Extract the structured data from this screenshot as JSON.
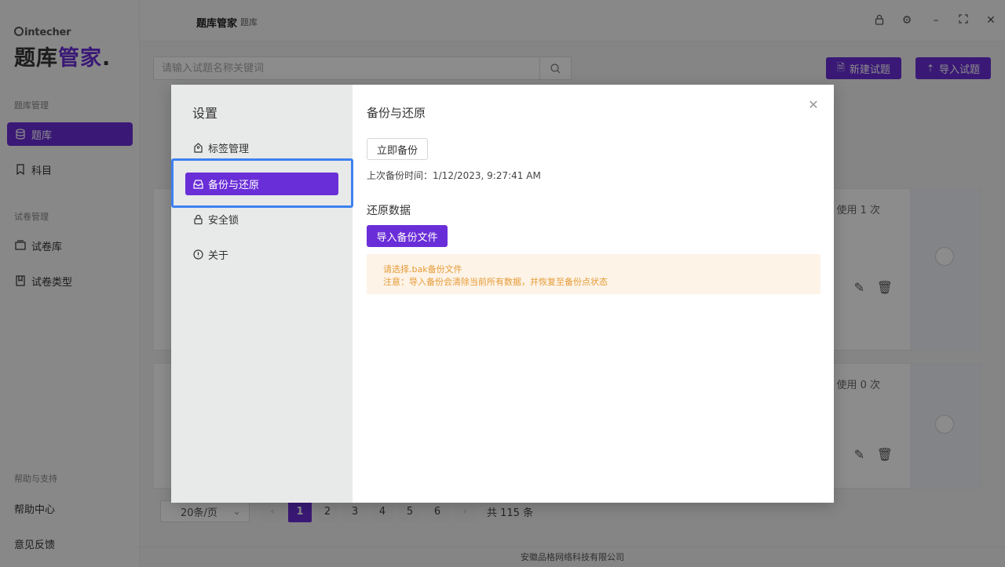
{
  "brand": {
    "small": "intecher",
    "big_main": "题库",
    "big_accent": "管家",
    "big_dot": "."
  },
  "sidebar": {
    "sections": [
      {
        "title": "题库管理",
        "items": [
          {
            "label": "题库",
            "icon": "database-icon",
            "active": true
          },
          {
            "label": "科目",
            "icon": "bookmark-icon",
            "active": false
          }
        ]
      },
      {
        "title": "试卷管理",
        "items": [
          {
            "label": "试卷库",
            "icon": "folder-icon",
            "active": false
          },
          {
            "label": "试卷类型",
            "icon": "book-icon",
            "active": false
          }
        ]
      },
      {
        "title": "帮助与支持",
        "items": [
          {
            "label": "帮助中心"
          },
          {
            "label": "意见反馈"
          }
        ]
      }
    ]
  },
  "topbar": {
    "title": "题库管家",
    "subtitle": "题库",
    "icons": [
      "lock-icon",
      "gear-icon",
      "minimize-icon",
      "fullscreen-icon",
      "close-icon"
    ]
  },
  "search": {
    "placeholder": "请输入试题名称关键词",
    "value": ""
  },
  "toolbar": {
    "new_label": "新建试题",
    "import_label": "导入试题"
  },
  "cards": [
    {
      "usage": "使用 1 次"
    },
    {
      "usage": "使用 0 次"
    }
  ],
  "pagination": {
    "page_size": "20条/页",
    "pages": [
      "1",
      "2",
      "3",
      "4",
      "5",
      "6"
    ],
    "current": "1",
    "total": "共 115 条"
  },
  "footer": {
    "company": "安徽品格网络科技有限公司"
  },
  "modal": {
    "title": "设置",
    "menu": [
      {
        "label": "标签管理",
        "icon": "tag-icon",
        "active": false
      },
      {
        "label": "备份与还原",
        "icon": "inbox-icon",
        "active": true
      },
      {
        "label": "安全锁",
        "icon": "lock-icon",
        "active": false
      },
      {
        "label": "关于",
        "icon": "info-icon",
        "active": false
      }
    ],
    "backup": {
      "heading": "备份与还原",
      "backup_now": "立即备份",
      "last_backup": "上次备份时间：1/12/2023, 9:27:41 AM",
      "restore_heading": "还原数据",
      "import_button": "导入备份文件",
      "notice_line1": "请选择.bak备份文件",
      "notice_line2": "注意：导入备份会清除当前所有数据，并恢复至备份点状态"
    }
  },
  "colors": {
    "accent": "#6a2ed8",
    "focus": "#3d82f0",
    "notice_bg": "#fdf3e7",
    "notice_text": "#e59b36"
  }
}
